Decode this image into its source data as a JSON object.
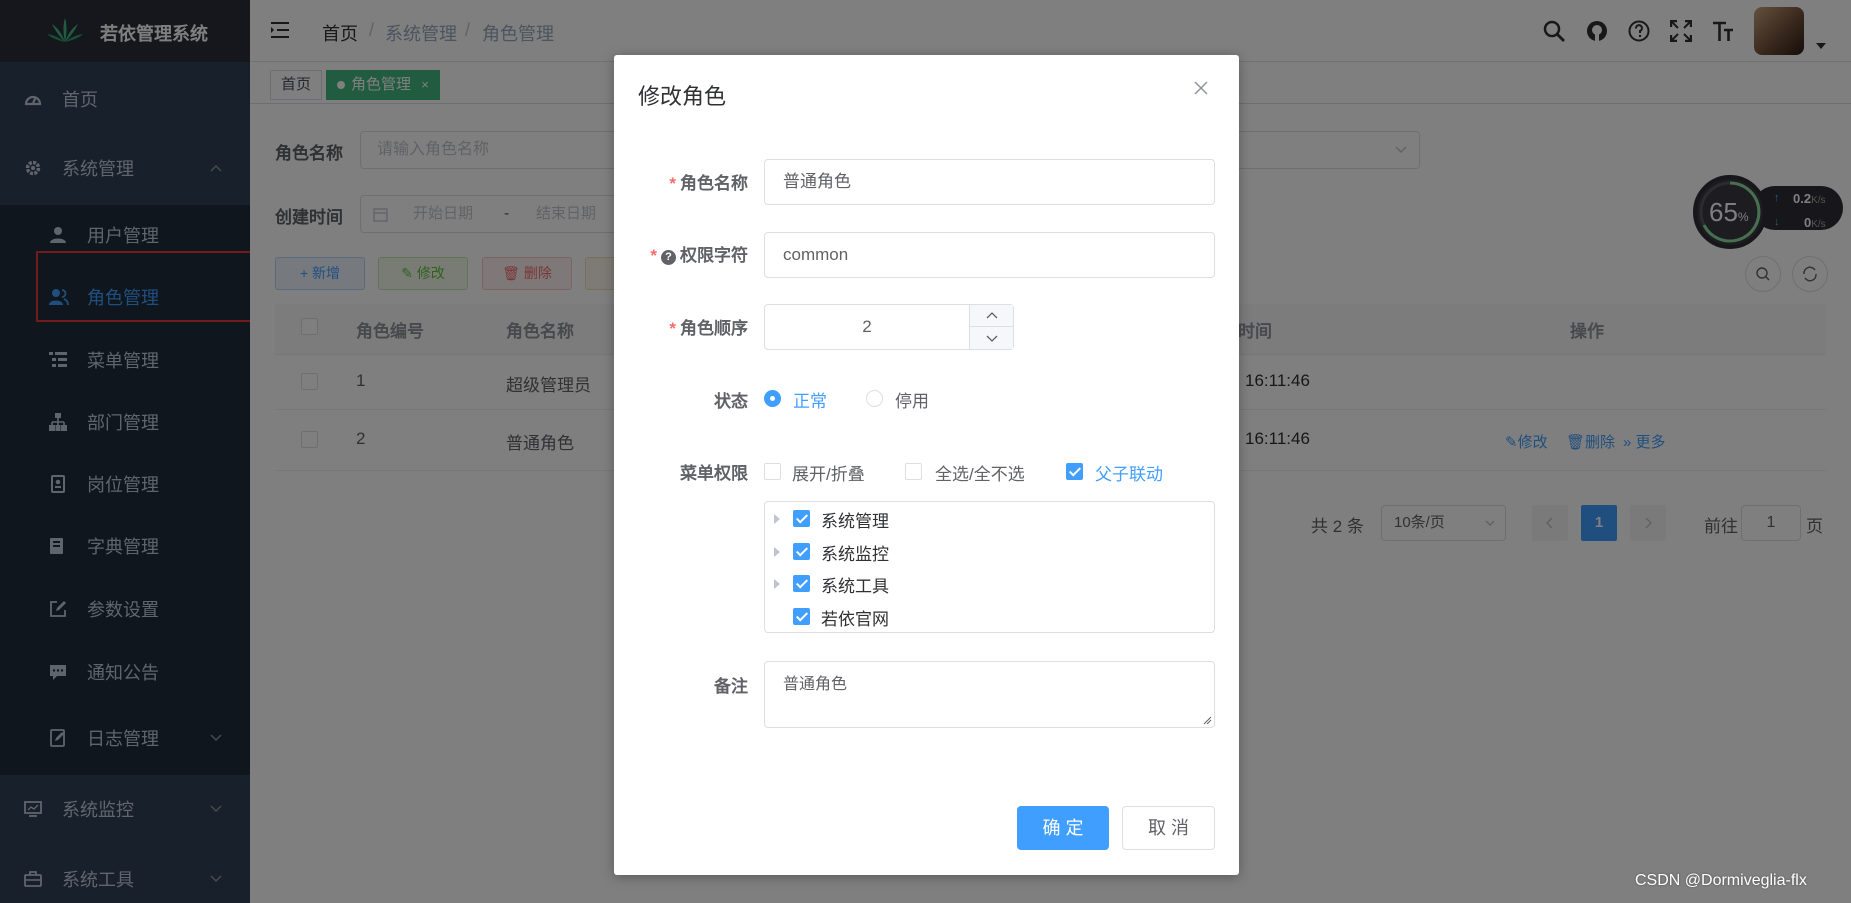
{
  "app": {
    "title": "若依管理系统"
  },
  "sidebar": {
    "items": [
      {
        "label": "首页",
        "icon": "dashboard-icon"
      },
      {
        "label": "系统管理",
        "icon": "gear-icon"
      },
      {
        "label": "用户管理",
        "icon": "user-icon"
      },
      {
        "label": "角色管理",
        "icon": "peoples-icon"
      },
      {
        "label": "菜单管理",
        "icon": "tree-table-icon"
      },
      {
        "label": "部门管理",
        "icon": "tree-icon"
      },
      {
        "label": "岗位管理",
        "icon": "post-icon"
      },
      {
        "label": "字典管理",
        "icon": "dict-icon"
      },
      {
        "label": "参数设置",
        "icon": "edit-icon"
      },
      {
        "label": "通知公告",
        "icon": "message-icon"
      },
      {
        "label": "日志管理",
        "icon": "log-icon"
      },
      {
        "label": "系统监控",
        "icon": "monitor-icon"
      },
      {
        "label": "系统工具",
        "icon": "tool-icon"
      }
    ]
  },
  "header": {
    "breadcrumb": [
      "首页",
      "系统管理",
      "角色管理"
    ],
    "sep": "/"
  },
  "tags": {
    "home": "首页",
    "active": "角色管理",
    "close": "×"
  },
  "search": {
    "role_name_label": "角色名称",
    "role_name_placeholder": "请输入角色名称",
    "create_time_label": "创建时间",
    "start_placeholder": "开始日期",
    "range_sep": "-",
    "end_placeholder": "结束日期"
  },
  "toolbar": {
    "add": "新增",
    "edit": "修改",
    "delete": "删除"
  },
  "table": {
    "headers": [
      "角色编号",
      "角色名称",
      "时间",
      "操作"
    ],
    "rows": [
      {
        "id": "1",
        "name": "超级管理员",
        "time": "16:11:46"
      },
      {
        "id": "2",
        "name": "普通角色",
        "time": "16:11:46",
        "ops": [
          "修改",
          "删除",
          "更多"
        ]
      }
    ]
  },
  "pagination": {
    "total": "共 2 条",
    "page_size": "10条/页",
    "current": "1",
    "goto": "前往",
    "goto_value": "1",
    "page_suffix": "页"
  },
  "net_widget": {
    "percent": "65",
    "percent_unit": "%",
    "up": "0.2",
    "down": "0",
    "unit": "K/s"
  },
  "dialog": {
    "title": "修改角色",
    "role_name_label": "角色名称",
    "role_name_value": "普通角色",
    "role_key_label": "权限字符",
    "role_key_value": "common",
    "role_sort_label": "角色顺序",
    "role_sort_value": "2",
    "status_label": "状态",
    "status_options": [
      "正常",
      "停用"
    ],
    "status_selected": "正常",
    "menu_perm_label": "菜单权限",
    "menu_perm_options": [
      {
        "label": "展开/折叠",
        "checked": false
      },
      {
        "label": "全选/全不选",
        "checked": false
      },
      {
        "label": "父子联动",
        "checked": true
      }
    ],
    "tree": [
      {
        "label": "系统管理",
        "checked": true,
        "expandable": true
      },
      {
        "label": "系统监控",
        "checked": true,
        "expandable": true
      },
      {
        "label": "系统工具",
        "checked": true,
        "expandable": true
      },
      {
        "label": "若依官网",
        "checked": true,
        "expandable": false
      }
    ],
    "remark_label": "备注",
    "remark_value": "普通角色",
    "confirm": "确 定",
    "cancel": "取 消"
  },
  "watermark": "CSDN @Dormiveglia-flx",
  "colors": {
    "primary": "#409eff",
    "sidebar_bg": "#304156",
    "sidebar_sub_bg": "#1f2d3d",
    "highlight_box": "#e53935",
    "danger": "#f56c6c"
  }
}
